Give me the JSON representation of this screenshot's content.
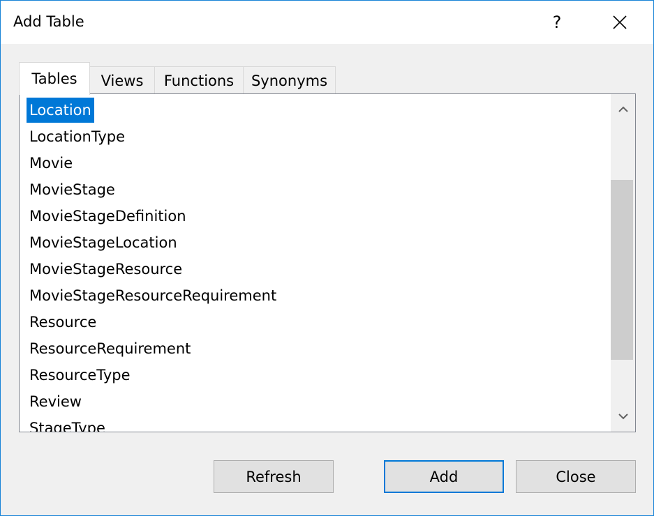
{
  "window": {
    "title": "Add Table",
    "help_label": "?"
  },
  "tabs": [
    {
      "label": "Tables",
      "active": true
    },
    {
      "label": "Views",
      "active": false
    },
    {
      "label": "Functions",
      "active": false
    },
    {
      "label": "Synonyms",
      "active": false
    }
  ],
  "list": {
    "selected": "Location",
    "items": [
      "Location",
      "LocationType",
      "Movie",
      "MovieStage",
      "MovieStageDefinition",
      "MovieStageLocation",
      "MovieStageResource",
      "MovieStageResourceRequirement",
      "Resource",
      "ResourceRequirement",
      "ResourceType",
      "Review",
      "StageType"
    ]
  },
  "buttons": {
    "refresh": "Refresh",
    "add": "Add",
    "close": "Close"
  },
  "colors": {
    "selection": "#0078d7",
    "window_border": "#1883d7"
  }
}
